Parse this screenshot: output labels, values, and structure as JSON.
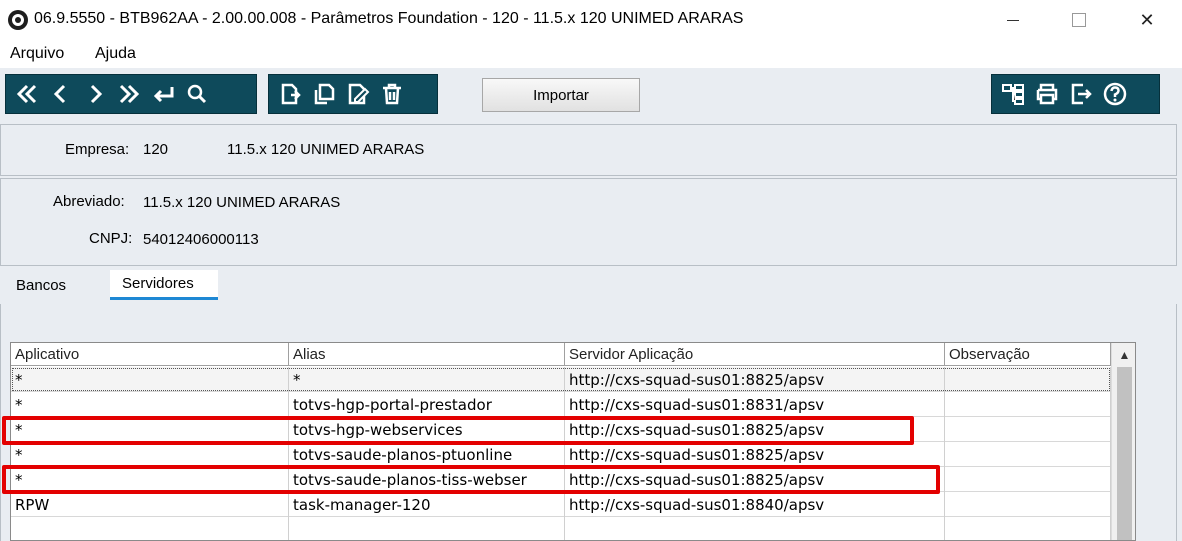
{
  "window": {
    "title": "06.9.5550 - BTB962AA - 2.00.00.008 - Parâmetros Foundation - 120 - 11.5.x 120 UNIMED ARARAS",
    "close_glyph": "✕"
  },
  "menu": [
    {
      "label": "Arquivo"
    },
    {
      "label": "Ajuda"
    }
  ],
  "toolbar": {
    "nav_icons": [
      "first-icon",
      "previous-icon",
      "next-icon",
      "last-icon",
      "goto-icon",
      "search-icon"
    ],
    "edit_icons": [
      "new-record-icon",
      "copy-record-icon",
      "edit-record-icon",
      "delete-record-icon"
    ],
    "import_label": "Importar",
    "right_icons": [
      "tree-icon",
      "print-icon",
      "exit-icon",
      "help-icon"
    ],
    "accent_color": "#0e4a5b"
  },
  "empresa": {
    "label": "Empresa:",
    "code": "120",
    "name": "11.5.x 120 UNIMED ARARAS"
  },
  "abreviado": {
    "label": "Abreviado:",
    "value": "11.5.x 120 UNIMED ARARAS"
  },
  "cnpj": {
    "label": "CNPJ:",
    "value": "54012406000113"
  },
  "tabs": [
    {
      "label": "Bancos",
      "active": false
    },
    {
      "label": "Servidores",
      "active": true
    }
  ],
  "grid": {
    "columns": [
      "Aplicativo",
      "Alias",
      "Servidor Aplicação",
      "Observação"
    ],
    "rows": [
      {
        "aplicativo": "*",
        "alias": "*",
        "servidor": "http://cxs-squad-sus01:8825/apsv",
        "observacao": ""
      },
      {
        "aplicativo": "*",
        "alias": "totvs-hgp-portal-prestador",
        "servidor": "http://cxs-squad-sus01:8831/apsv",
        "observacao": ""
      },
      {
        "aplicativo": "*",
        "alias": "totvs-hgp-webservices",
        "servidor": "http://cxs-squad-sus01:8825/apsv",
        "observacao": ""
      },
      {
        "aplicativo": "*",
        "alias": "totvs-saude-planos-ptuonline",
        "servidor": "http://cxs-squad-sus01:8825/apsv",
        "observacao": ""
      },
      {
        "aplicativo": "*",
        "alias": "totvs-saude-planos-tiss-webser",
        "servidor": "http://cxs-squad-sus01:8825/apsv",
        "observacao": ""
      },
      {
        "aplicativo": "RPW",
        "alias": "task-manager-120",
        "servidor": "http://cxs-squad-sus01:8840/apsv",
        "observacao": ""
      }
    ],
    "highlight_color": "#e30000"
  }
}
